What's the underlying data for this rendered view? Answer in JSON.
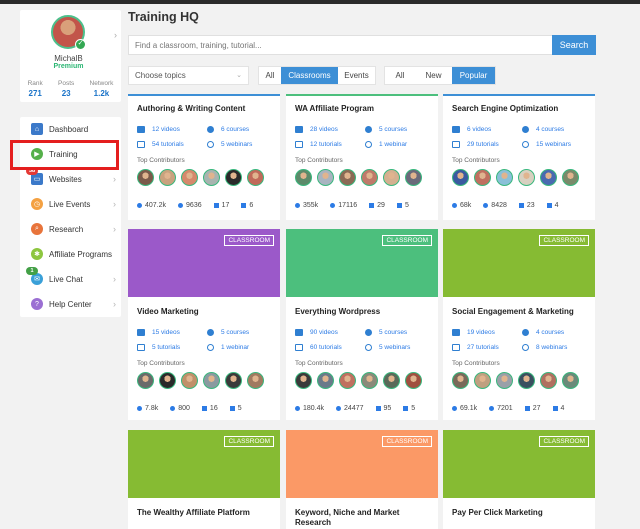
{
  "page": {
    "title": "Training HQ"
  },
  "profile": {
    "name": "MichalB",
    "status": "Premium",
    "stats": [
      {
        "label": "Rank",
        "value": "271"
      },
      {
        "label": "Posts",
        "value": "23"
      },
      {
        "label": "Network",
        "value": "1.2k"
      }
    ]
  },
  "nav": {
    "items": [
      {
        "label": "Dashboard",
        "icon": "house-icon",
        "color": "#3b79c9"
      },
      {
        "label": "Training",
        "icon": "play-icon",
        "color": "#55b04a"
      },
      {
        "label": "Websites",
        "icon": "browser-icon",
        "color": "#3b79c9",
        "badge": "38"
      },
      {
        "label": "Live Events",
        "icon": "clock-icon",
        "color": "#f4a142"
      },
      {
        "label": "Research",
        "icon": "magnifier-icon",
        "color": "#e8743b"
      },
      {
        "label": "Affiliate Programs",
        "icon": "puzzle-icon",
        "color": "#8dc63f"
      },
      {
        "label": "Live Chat",
        "icon": "chat-icon",
        "color": "#3aa0d8",
        "badge": "1"
      },
      {
        "label": "Help Center",
        "icon": "lifebuoy-icon",
        "color": "#9b6fd3"
      }
    ]
  },
  "search": {
    "placeholder": "Find a classroom, training, tutorial...",
    "button": "Search"
  },
  "filters": {
    "topic_placeholder": "Choose topics",
    "type_options": [
      "All",
      "Classrooms",
      "Events"
    ],
    "sort_options": [
      "All",
      "New",
      "Popular"
    ]
  },
  "labels": {
    "top_contributors": "Top Contributors",
    "classroom_tag": "CLASSROOM"
  },
  "cards": [
    {
      "title": "Authoring & Writing Content",
      "videos": "12 videos",
      "courses": "6 courses",
      "tutorials": "54 tutorials",
      "webinars": "5 webinars",
      "views": "407.2k",
      "questions": "9636",
      "members": "17",
      "bookmarks": "6"
    },
    {
      "title": "WA Affiliate Program",
      "videos": "28 videos",
      "courses": "5 courses",
      "tutorials": "12 tutorials",
      "webinars": "1 webinar",
      "views": "355k",
      "questions": "17116",
      "members": "29",
      "bookmarks": "5"
    },
    {
      "title": "Search Engine Optimization",
      "videos": "6 videos",
      "courses": "4 courses",
      "tutorials": "29 tutorials",
      "webinars": "15 webinars",
      "views": "68k",
      "questions": "8428",
      "members": "23",
      "bookmarks": "4"
    },
    {
      "title": "Video Marketing",
      "videos": "15 videos",
      "courses": "5 courses",
      "tutorials": "5 tutorials",
      "webinars": "1 webinar",
      "views": "7.8k",
      "questions": "800",
      "members": "16",
      "bookmarks": "5",
      "banner": "#9b59c9"
    },
    {
      "title": "Everything Wordpress",
      "videos": "90 videos",
      "courses": "5 courses",
      "tutorials": "60 tutorials",
      "webinars": "5 webinars",
      "views": "180.4k",
      "questions": "24477",
      "members": "95",
      "bookmarks": "5",
      "banner": "#4cbf7d"
    },
    {
      "title": "Social Engagement & Marketing",
      "videos": "19 videos",
      "courses": "4 courses",
      "tutorials": "27 tutorials",
      "webinars": "8 webinars",
      "views": "69.1k",
      "questions": "7201",
      "members": "27",
      "bookmarks": "4",
      "banner": "#86bb33"
    },
    {
      "title": "The Wealthy Affiliate Platform",
      "banner": "#86bb33"
    },
    {
      "title": "Keyword, Niche and Market Research",
      "banner": "#fb9966"
    },
    {
      "title": "Pay Per Click Marketing",
      "banner": "#86bb33"
    }
  ]
}
